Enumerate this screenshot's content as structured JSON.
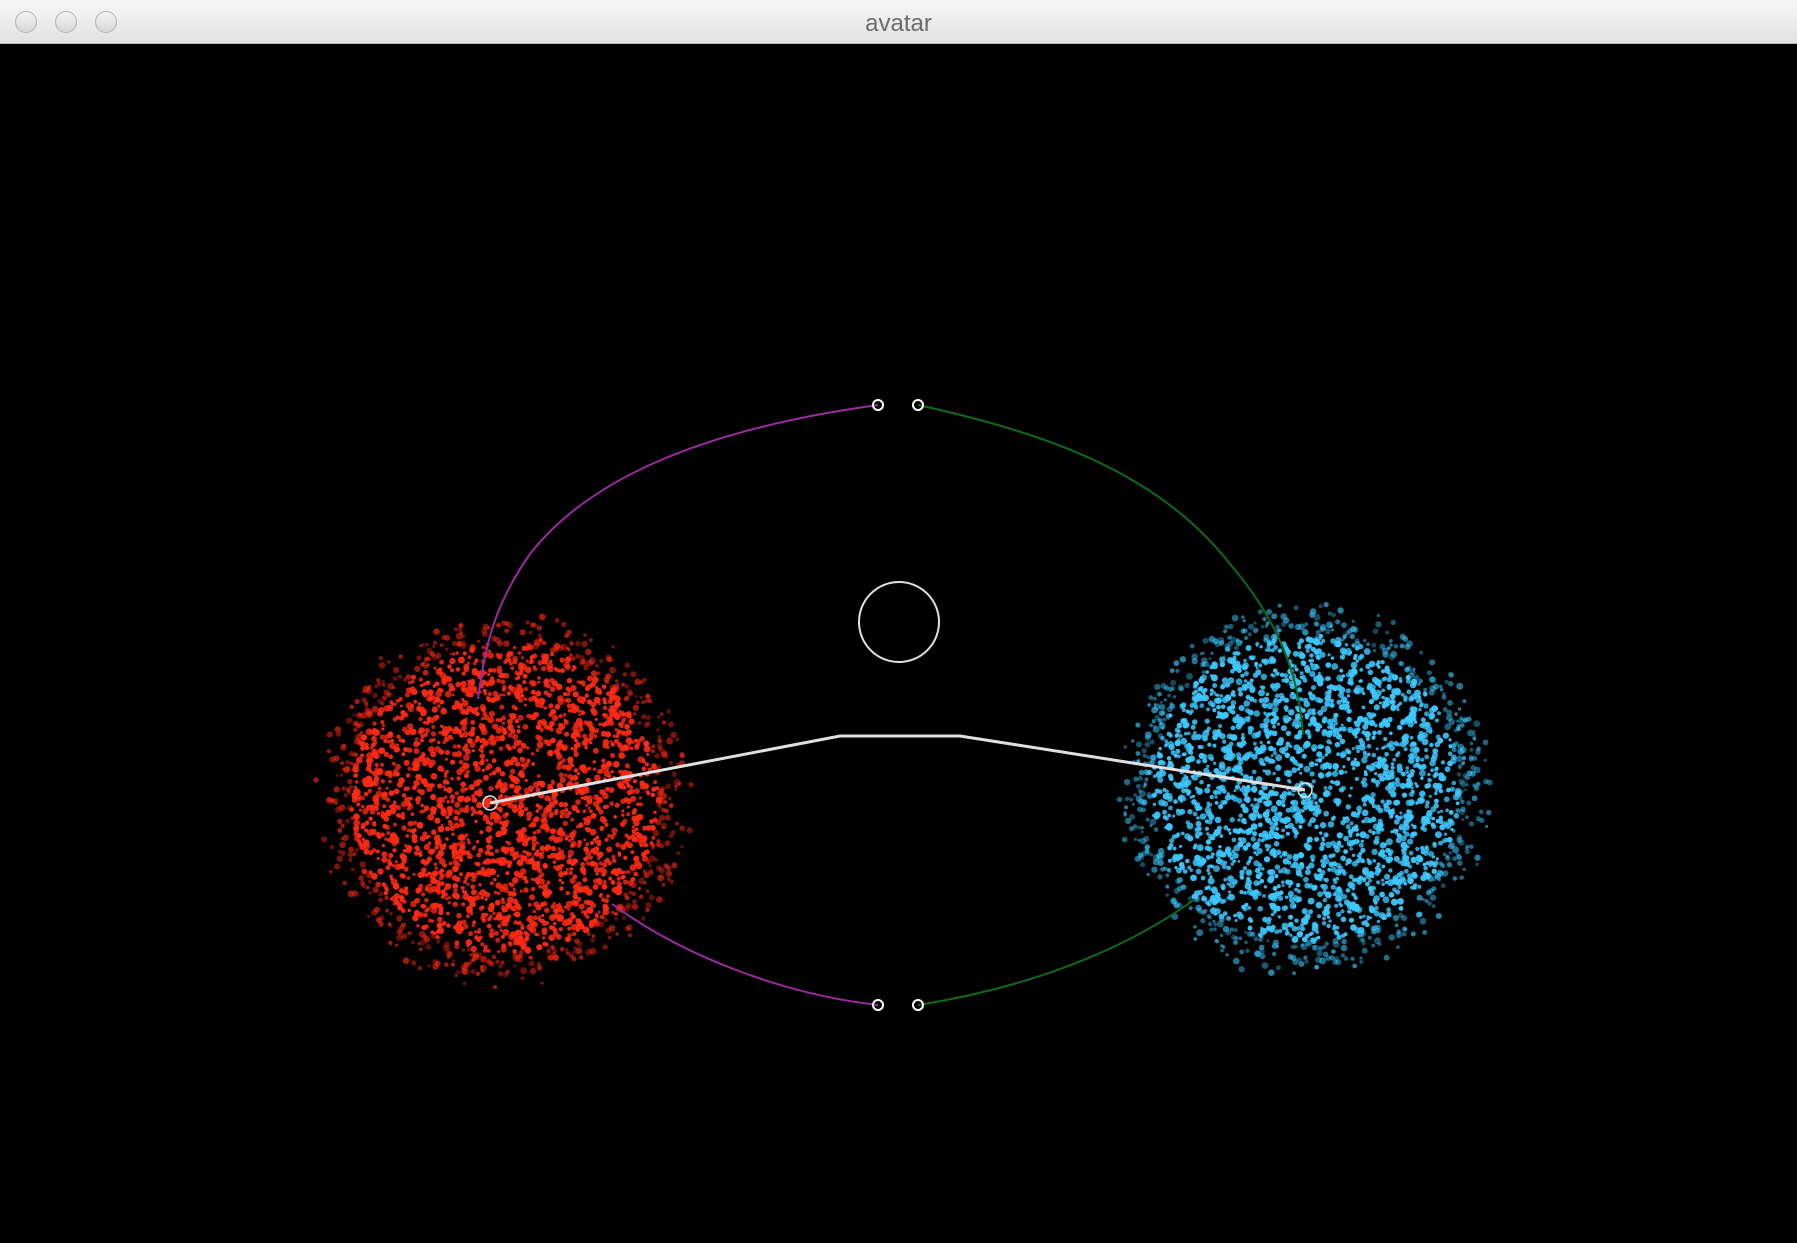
{
  "window": {
    "title": "avatar",
    "controls": [
      "close",
      "minimize",
      "zoom"
    ]
  },
  "scene": {
    "background": "#000000",
    "left_cloud_color": "#ff2a14",
    "right_cloud_color": "#3cc8ff",
    "left_arc_color": "#9c2aa0",
    "right_arc_color": "#0f6a1e",
    "link_color": "#e0e0e0",
    "handle_color": "#ffffff"
  }
}
